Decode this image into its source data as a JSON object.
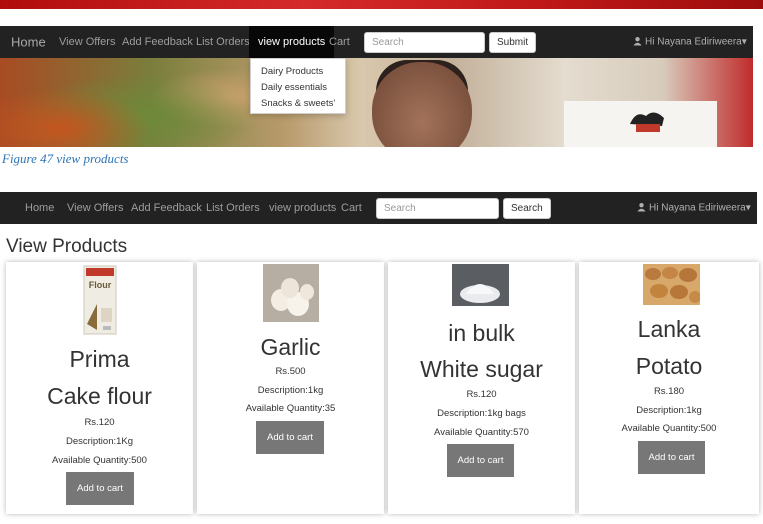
{
  "top_nav": {
    "brand": "Home",
    "links": [
      "View Offers",
      "Add Feedback",
      "List Orders",
      "view products",
      "Cart"
    ],
    "search_placeholder": "Search",
    "submit_label": "Submit",
    "user_label": "Hi Nayana Ediriweera",
    "dropdown_items": [
      "Dairy Products",
      "Daily essentials",
      "Snacks & sweets'"
    ]
  },
  "caption": "Figure 47 view products",
  "bottom_nav": {
    "brand": "Home",
    "links": [
      "View Offers",
      "Add Feedback",
      "List Orders",
      "view products",
      "Cart"
    ],
    "search_placeholder": "Search",
    "search_label": "Search",
    "user_label": "Hi Nayana Ediriweera"
  },
  "page_title": "View Products",
  "products": [
    {
      "name_line1": "Prima",
      "name_line2": "Cake flour",
      "price": "Rs.120",
      "description": "Description:1Kg",
      "quantity": "Available Quantity:500",
      "button": "Add to cart"
    },
    {
      "name_line1": "Garlic",
      "price": "Rs.500",
      "description": "Description:1kg",
      "quantity": "Available Quantity:35",
      "button": "Add to cart"
    },
    {
      "name_line1": "in bulk",
      "name_line2": "White sugar",
      "price": "Rs.120",
      "description": "Description:1kg bags",
      "quantity": "Available Quantity:570",
      "button": "Add to cart"
    },
    {
      "name_line1": "Lanka",
      "name_line2": "Potato",
      "price": "Rs.180",
      "description": "Description:1kg",
      "quantity": "Available Quantity:500",
      "button": "Add to cart"
    }
  ],
  "colors": {
    "navbar": "#222222",
    "active_tab": "#080808",
    "caption": "#2e74b5",
    "cart_button": "#777777"
  }
}
